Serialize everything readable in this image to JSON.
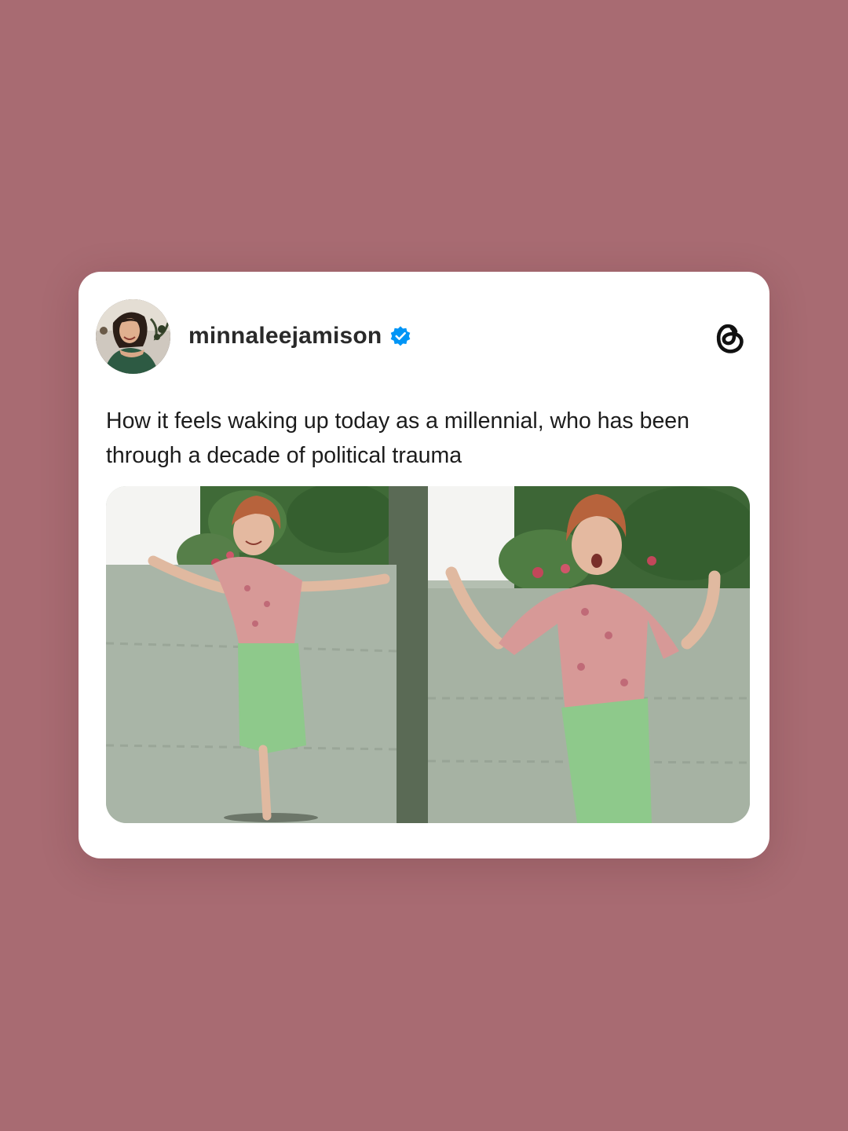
{
  "post": {
    "username": "minnaleejamison",
    "verified": true,
    "text": "How it feels waking up today as a millennial, who has been through a decade of political trauma",
    "media_count": 2
  },
  "colors": {
    "background": "#a86b72",
    "card": "#ffffff",
    "verified_badge": "#0095f6",
    "text": "#1c1c1c"
  },
  "icons": {
    "verified": "verified-badge-icon",
    "brand": "threads-logo-icon"
  }
}
